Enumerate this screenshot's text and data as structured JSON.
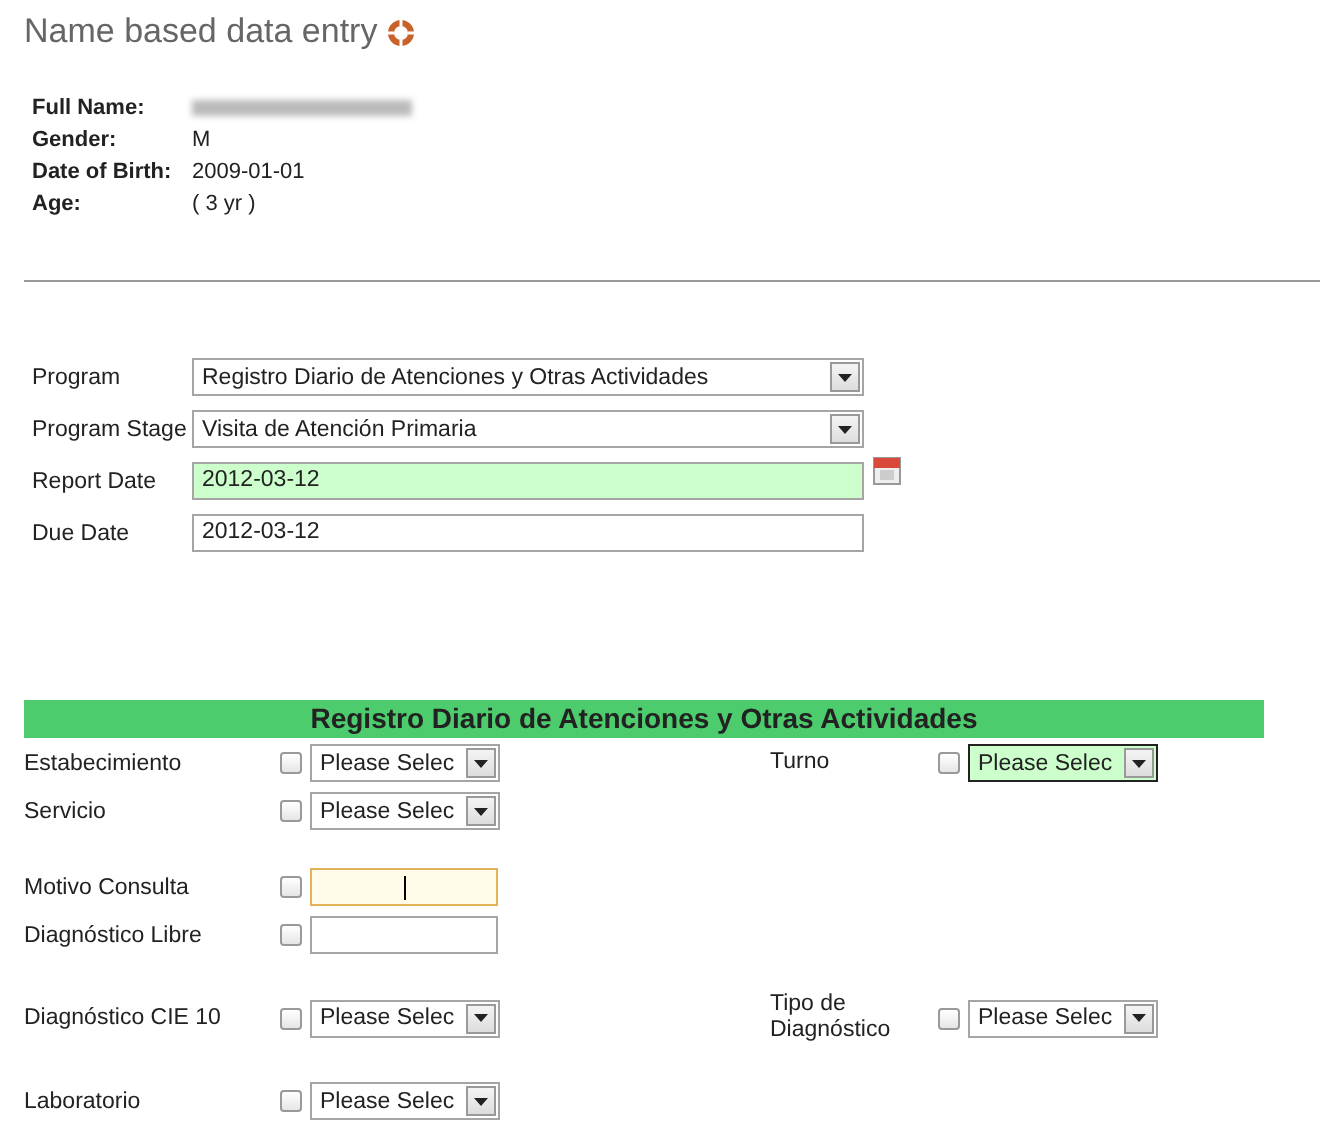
{
  "header": {
    "title": "Name based data entry"
  },
  "patient": [
    {
      "label": "Full Name:",
      "kind": "redacted"
    },
    {
      "label": "Gender:",
      "value": "M"
    },
    {
      "label": "Date of Birth:",
      "value": "2009-01-01"
    },
    {
      "label": "Age:",
      "value": "( 3 yr )"
    }
  ],
  "program_form": [
    {
      "label": "Program",
      "kind": "select",
      "value": "Registro Diario de Atenciones y Otras Actividades",
      "highlighted": false
    },
    {
      "label": "Program Stage",
      "kind": "select",
      "value": "Visita de Atención Primaria",
      "highlighted": false
    },
    {
      "label": "Report Date",
      "kind": "date",
      "value": "2012-03-12",
      "highlighted": true
    },
    {
      "label": "Due Date",
      "kind": "text",
      "value": "2012-03-12",
      "highlighted": false
    }
  ],
  "section": {
    "title": "Registro Diario de Atenciones y Otras Actividades",
    "groups": [
      {
        "rows": [
          [
            {
              "label": "Estabecimiento",
              "kind": "select",
              "value": "Please Selec",
              "checked": false,
              "highlighted": false
            },
            {
              "label": "Turno",
              "kind": "select",
              "value": "Please Selec",
              "checked": false,
              "highlighted": true
            }
          ],
          [
            {
              "label": "Servicio",
              "kind": "select",
              "value": "Please Selec",
              "checked": false,
              "highlighted": false
            }
          ]
        ]
      },
      {
        "rows": [
          [
            {
              "label": "Motivo Consulta",
              "kind": "text",
              "checked": false,
              "focused": true
            }
          ],
          [
            {
              "label": "Diagnóstico Libre",
              "kind": "text",
              "checked": false,
              "focused": false
            }
          ]
        ]
      },
      {
        "rows": [
          [
            {
              "label": "Diagnóstico CIE 10",
              "kind": "select",
              "value": "Please Selec",
              "checked": false,
              "highlighted": false
            },
            {
              "label": "Tipo de Diagnóstico",
              "kind": "select",
              "value": "Please Selec",
              "checked": false,
              "highlighted": false
            }
          ]
        ]
      },
      {
        "rows": [
          [
            {
              "label": "Laboratorio",
              "kind": "select",
              "value": "Please Selec",
              "checked": false,
              "highlighted": false
            }
          ]
        ]
      }
    ]
  }
}
